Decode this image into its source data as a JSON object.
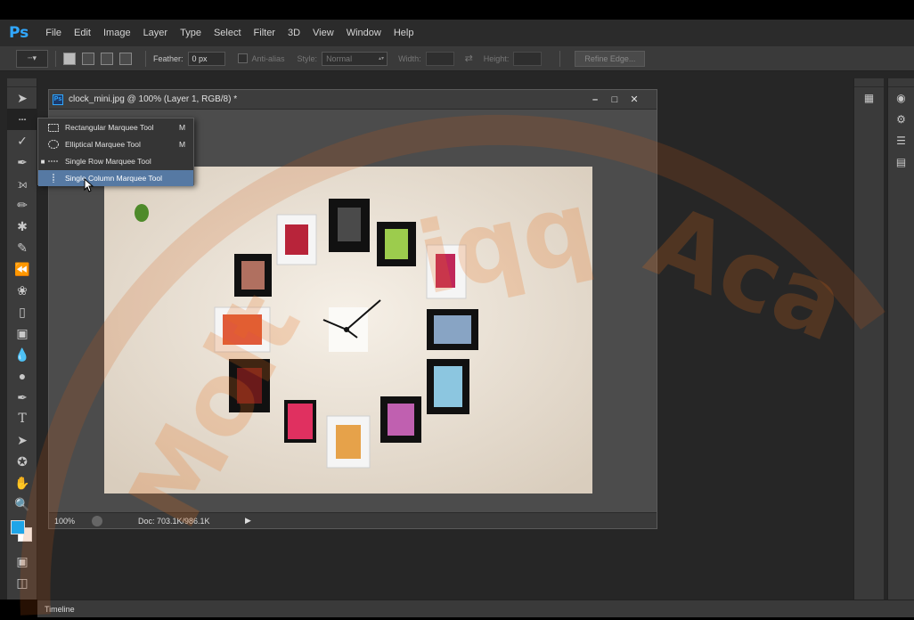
{
  "app": {
    "logo": "Ps"
  },
  "menu": [
    "File",
    "Edit",
    "Image",
    "Layer",
    "Type",
    "Select",
    "Filter",
    "3D",
    "View",
    "Window",
    "Help"
  ],
  "options": {
    "feather_label": "Feather:",
    "feather_value": "0 px",
    "antialias_label": "Anti-alias",
    "style_label": "Style:",
    "style_value": "Normal",
    "width_label": "Width:",
    "height_label": "Height:",
    "refine_edge": "Refine Edge..."
  },
  "document": {
    "title": "clock_mini.jpg @ 100% (Layer 1, RGB/8) *",
    "zoom": "100%",
    "doc_size": "Doc: 703.1K/986.1K"
  },
  "flyout": [
    {
      "label": "Rectangular Marquee Tool",
      "key": "M",
      "icon": "rect-marquee-icon",
      "active": false,
      "highlighted": false
    },
    {
      "label": "Elliptical Marquee Tool",
      "key": "M",
      "icon": "ellipse-marquee-icon",
      "active": false,
      "highlighted": false
    },
    {
      "label": "Single Row Marquee Tool",
      "key": "",
      "icon": "row-marquee-icon",
      "active": true,
      "highlighted": false
    },
    {
      "label": "Single Column Marquee Tool",
      "key": "",
      "icon": "column-marquee-icon",
      "active": false,
      "highlighted": true
    }
  ],
  "timeline": {
    "label": "Timeline"
  },
  "colors": {
    "foreground": "#1ea5e8",
    "background": "#ffffff",
    "accent": "#31a8ff",
    "highlight": "#5679a3"
  },
  "watermark": {
    "text": "Moltiqq Academy"
  }
}
